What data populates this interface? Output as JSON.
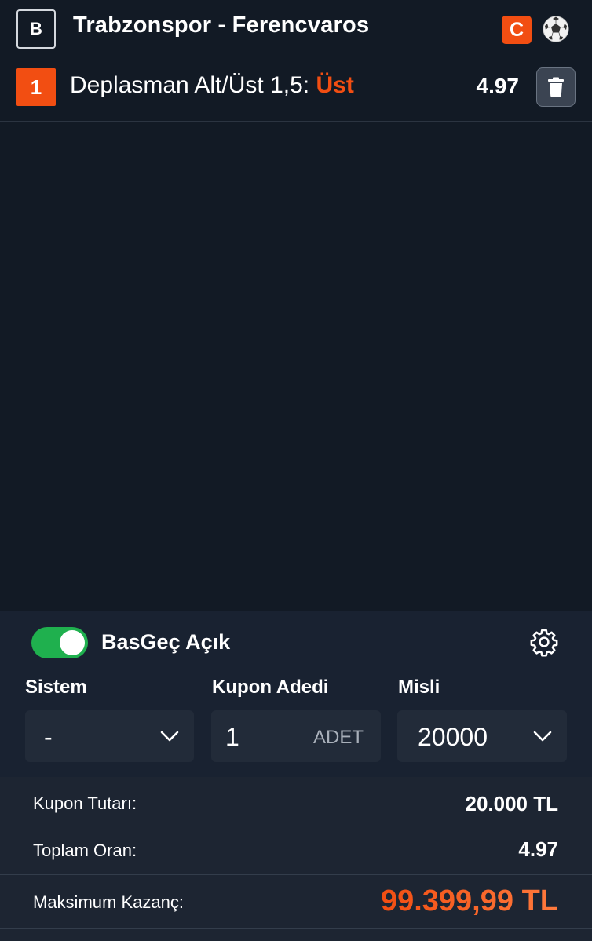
{
  "match": {
    "badge_letter": "B",
    "title": "Trabzonspor - Ferencvaros",
    "live_badge": "C",
    "sport_icon": "soccer-ball-icon"
  },
  "selection": {
    "number": "1",
    "market": "Deplasman Alt/Üst 1,5:",
    "pick": "Üst",
    "odds": "4.97",
    "delete_icon": "trash-icon"
  },
  "panel": {
    "toggle_label": "BasGeç Açık",
    "toggle_on": true,
    "settings_icon": "gear-icon",
    "sistem": {
      "label": "Sistem",
      "value": "-"
    },
    "kupon_adedi": {
      "label": "Kupon Adedi",
      "value": "1",
      "unit": "ADET"
    },
    "misli": {
      "label": "Misli",
      "value": "20000"
    }
  },
  "summary": {
    "kupon_tutari_label": "Kupon Tutarı:",
    "kupon_tutari_value": "20.000 TL",
    "toplam_oran_label": "Toplam Oran:",
    "toplam_oran_value": "4.97",
    "maksimum_kazanc_label": "Maksimum Kazanç:",
    "maksimum_kazanc_value": "99.399,99 TL"
  },
  "colors": {
    "background": "#121a25",
    "accent_orange": "#f24e12",
    "toggle_green": "#1fb04e",
    "max_gain_gradient_start": "#f24e12",
    "max_gain_gradient_end": "#ff7a3d"
  }
}
